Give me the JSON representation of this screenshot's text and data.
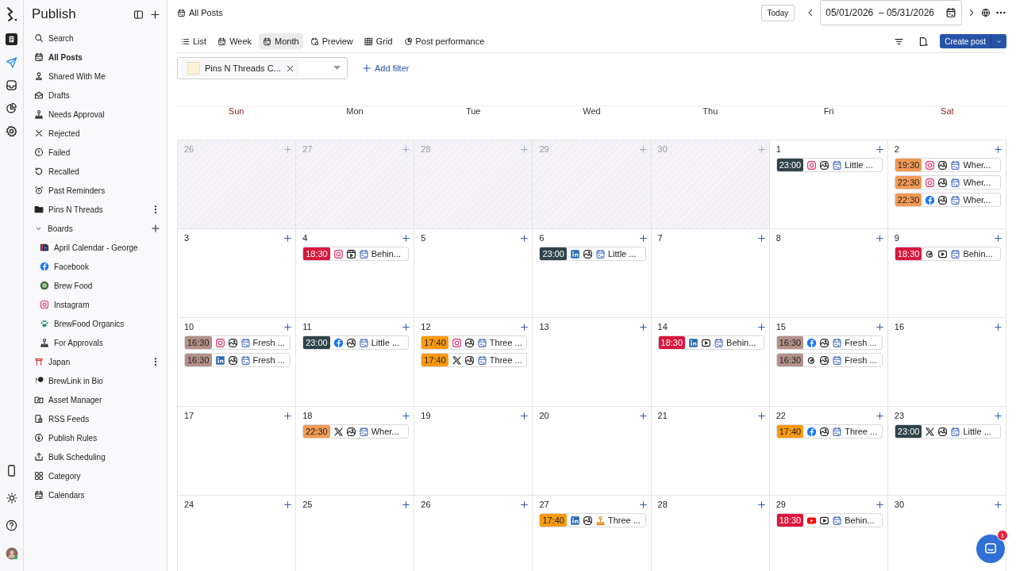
{
  "sidebar": {
    "title": "Publish",
    "items": [
      {
        "label": "Search",
        "selected": false
      },
      {
        "label": "All Posts",
        "selected": true
      },
      {
        "label": "Shared With Me",
        "selected": false
      },
      {
        "label": "Drafts",
        "selected": false
      },
      {
        "label": "Needs Approval",
        "selected": false
      },
      {
        "label": "Rejected",
        "selected": false
      },
      {
        "label": "Failed",
        "selected": false
      },
      {
        "label": "Recalled",
        "selected": false
      },
      {
        "label": "Past Reminders",
        "selected": false
      },
      {
        "label": "Pins N Threads",
        "selected": false
      },
      {
        "label": "Boards",
        "selected": false,
        "expanded": true,
        "children": [
          {
            "label": "April Calendar - George",
            "selected": false
          },
          {
            "label": "Facebook",
            "selected": false
          },
          {
            "label": "Brew Food",
            "selected": false
          },
          {
            "label": "Instagram",
            "selected": false
          },
          {
            "label": "BrewFood Organics",
            "selected": false
          },
          {
            "label": "For Approvals",
            "selected": false
          }
        ]
      },
      {
        "label": "Japan",
        "selected": false
      },
      {
        "label": "BrewLink in Bio",
        "selected": false
      },
      {
        "label": "Asset Manager",
        "selected": false
      },
      {
        "label": "RSS Feeds",
        "selected": false
      },
      {
        "label": "Publish Rules",
        "selected": false
      },
      {
        "label": "Bulk Scheduling",
        "selected": false
      },
      {
        "label": "Category",
        "selected": false
      },
      {
        "label": "Calendars",
        "selected": false
      }
    ]
  },
  "header": {
    "title": "All Posts",
    "today": "Today",
    "date_range": "05/01/2026  – 05/31/2026"
  },
  "tabs": [
    {
      "label": "List",
      "selected": false
    },
    {
      "label": "Week",
      "selected": false
    },
    {
      "label": "Month",
      "selected": true
    },
    {
      "label": "Preview",
      "selected": false
    },
    {
      "label": "Grid",
      "selected": false
    },
    {
      "label": "Post performance",
      "selected": false
    }
  ],
  "create_button": "Create post",
  "filter": {
    "chip": "Pins N Threads C...",
    "color": "#fbf1d3",
    "add": "Add filter"
  },
  "weekdays": [
    {
      "label": "Sun",
      "weekend": true
    },
    {
      "label": "Mon",
      "weekend": false
    },
    {
      "label": "Tue",
      "weekend": false
    },
    {
      "label": "Wed",
      "weekend": false
    },
    {
      "label": "Thu",
      "weekend": false
    },
    {
      "label": "Fri",
      "weekend": false
    },
    {
      "label": "Sat",
      "weekend": true
    }
  ],
  "days": [
    {
      "day": "26",
      "outside": true
    },
    {
      "day": "27",
      "outside": true
    },
    {
      "day": "28",
      "outside": true
    },
    {
      "day": "29",
      "outside": true
    },
    {
      "day": "30",
      "outside": true
    },
    {
      "day": "1",
      "outside": false,
      "posts": [
        {
          "time": "23:00",
          "color": "#2f4449",
          "icons": [
            {
              "kind": "instagram"
            },
            {
              "kind": "image"
            },
            {
              "kind": "scheduled"
            }
          ],
          "title": "Little ..."
        }
      ]
    },
    {
      "day": "2",
      "outside": false,
      "posts": [
        {
          "time": "19:30",
          "color": "#f29a55",
          "icons": [
            {
              "kind": "instagram"
            },
            {
              "kind": "image"
            },
            {
              "kind": "scheduled"
            }
          ],
          "title": "Wher..."
        },
        {
          "time": "22:30",
          "color": "#f29a55",
          "icons": [
            {
              "kind": "instagram"
            },
            {
              "kind": "image"
            },
            {
              "kind": "scheduled"
            }
          ],
          "title": "Wher..."
        },
        {
          "time": "22:30",
          "color": "#f29a55",
          "icons": [
            {
              "kind": "facebook"
            },
            {
              "kind": "image"
            },
            {
              "kind": "scheduled"
            }
          ],
          "title": "Wher..."
        }
      ]
    },
    {
      "day": "3",
      "outside": false
    },
    {
      "day": "4",
      "outside": false,
      "posts": [
        {
          "time": "18:30",
          "color": "#d9163d",
          "icons": [
            {
              "kind": "instagram"
            },
            {
              "kind": "reel"
            },
            {
              "kind": "scheduled"
            }
          ],
          "title": "Behin..."
        }
      ]
    },
    {
      "day": "5",
      "outside": false
    },
    {
      "day": "6",
      "outside": false,
      "posts": [
        {
          "time": "23:00",
          "color": "#2f4449",
          "icons": [
            {
              "kind": "linkedin"
            },
            {
              "kind": "image"
            },
            {
              "kind": "scheduled"
            }
          ],
          "title": "Little ..."
        }
      ]
    },
    {
      "day": "7",
      "outside": false
    },
    {
      "day": "8",
      "outside": false
    },
    {
      "day": "9",
      "outside": false,
      "posts": [
        {
          "time": "18:30",
          "color": "#d9163d",
          "icons": [
            {
              "kind": "threads"
            },
            {
              "kind": "video"
            },
            {
              "kind": "scheduled"
            }
          ],
          "title": "Behin..."
        }
      ]
    },
    {
      "day": "10",
      "outside": false,
      "posts": [
        {
          "time": "16:30",
          "color": "#b39188",
          "icons": [
            {
              "kind": "instagram"
            },
            {
              "kind": "image"
            },
            {
              "kind": "scheduled"
            }
          ],
          "title": "Fresh ..."
        },
        {
          "time": "16:30",
          "color": "#b39188",
          "icons": [
            {
              "kind": "linkedin"
            },
            {
              "kind": "image"
            },
            {
              "kind": "scheduled"
            }
          ],
          "title": "Fresh ..."
        }
      ]
    },
    {
      "day": "11",
      "outside": false,
      "posts": [
        {
          "time": "23:00",
          "color": "#2f4449",
          "icons": [
            {
              "kind": "facebook"
            },
            {
              "kind": "image"
            },
            {
              "kind": "scheduled"
            }
          ],
          "title": "Little ..."
        }
      ]
    },
    {
      "day": "12",
      "outside": false,
      "posts": [
        {
          "time": "17:40",
          "color": "#fb9a0e",
          "icons": [
            {
              "kind": "instagram"
            },
            {
              "kind": "image"
            },
            {
              "kind": "scheduled"
            }
          ],
          "title": "Three ..."
        },
        {
          "time": "17:40",
          "color": "#fb9a0e",
          "icons": [
            {
              "kind": "x"
            },
            {
              "kind": "image"
            },
            {
              "kind": "scheduled"
            }
          ],
          "title": "Three ..."
        }
      ]
    },
    {
      "day": "13",
      "outside": false
    },
    {
      "day": "14",
      "outside": false,
      "posts": [
        {
          "time": "18:30",
          "color": "#d9163d",
          "icons": [
            {
              "kind": "linkedin"
            },
            {
              "kind": "video"
            },
            {
              "kind": "scheduled"
            }
          ],
          "title": "Behin..."
        }
      ]
    },
    {
      "day": "15",
      "outside": false,
      "posts": [
        {
          "time": "16:30",
          "color": "#b39188",
          "icons": [
            {
              "kind": "facebook"
            },
            {
              "kind": "image"
            },
            {
              "kind": "scheduled"
            }
          ],
          "title": "Fresh ..."
        },
        {
          "time": "16:30",
          "color": "#b39188",
          "icons": [
            {
              "kind": "threads"
            },
            {
              "kind": "image"
            },
            {
              "kind": "scheduled"
            }
          ],
          "title": "Fresh ..."
        }
      ]
    },
    {
      "day": "16",
      "outside": false
    },
    {
      "day": "17",
      "outside": false
    },
    {
      "day": "18",
      "outside": false,
      "posts": [
        {
          "time": "22:30",
          "color": "#f29a55",
          "icons": [
            {
              "kind": "x"
            },
            {
              "kind": "image"
            },
            {
              "kind": "scheduled"
            }
          ],
          "title": "Wher..."
        }
      ]
    },
    {
      "day": "19",
      "outside": false
    },
    {
      "day": "20",
      "outside": false
    },
    {
      "day": "21",
      "outside": false
    },
    {
      "day": "22",
      "outside": false,
      "posts": [
        {
          "time": "17:40",
          "color": "#fb9a0e",
          "icons": [
            {
              "kind": "facebook"
            },
            {
              "kind": "image"
            },
            {
              "kind": "scheduled"
            }
          ],
          "title": "Three ..."
        }
      ]
    },
    {
      "day": "23",
      "outside": false,
      "posts": [
        {
          "time": "23:00",
          "color": "#2f4449",
          "icons": [
            {
              "kind": "x"
            },
            {
              "kind": "image"
            },
            {
              "kind": "scheduled"
            }
          ],
          "title": "Little ..."
        }
      ]
    },
    {
      "day": "24",
      "outside": false
    },
    {
      "day": "25",
      "outside": false
    },
    {
      "day": "26",
      "outside": false
    },
    {
      "day": "27",
      "outside": false,
      "posts": [
        {
          "time": "17:40",
          "color": "#fb9a0e",
          "icons": [
            {
              "kind": "linkedin"
            },
            {
              "kind": "image"
            },
            {
              "kind": "approval"
            }
          ],
          "title": "Three ..."
        }
      ]
    },
    {
      "day": "28",
      "outside": false
    },
    {
      "day": "29",
      "outside": false,
      "posts": [
        {
          "time": "18:30",
          "color": "#d9163d",
          "icons": [
            {
              "kind": "youtube"
            },
            {
              "kind": "video"
            },
            {
              "kind": "scheduled"
            }
          ],
          "title": "Behin..."
        }
      ]
    },
    {
      "day": "30",
      "outside": false
    }
  ],
  "chat_badge": "1"
}
